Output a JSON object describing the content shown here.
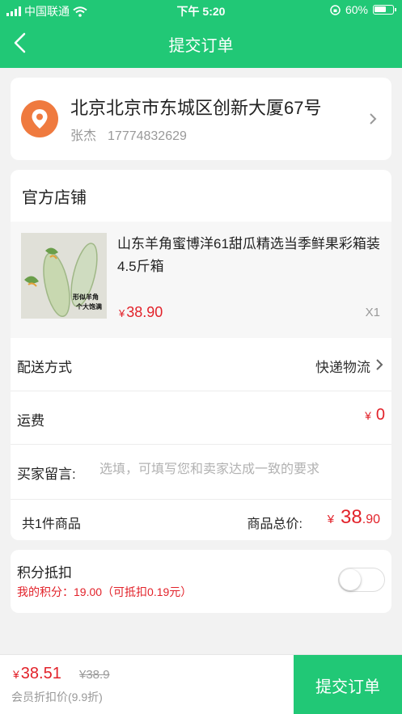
{
  "status_bar": {
    "carrier": "中国联通",
    "time": "下午 5:20",
    "battery": "60%"
  },
  "header": {
    "title": "提交订单",
    "bg_color": "#21c876"
  },
  "address": {
    "line": "北京北京市东城区创新大厦67号",
    "name": "张杰",
    "phone": "17774832629"
  },
  "shop": {
    "name": "官方店铺"
  },
  "product": {
    "title": "山东羊角蜜博洋61甜瓜精选当季鲜果彩箱装4.5斤箱",
    "image_text_1": "形似羊角",
    "image_text_2": "个大饱满",
    "currency": "¥",
    "price": "38.90",
    "qty": "X1"
  },
  "delivery": {
    "label": "配送方式",
    "value": "快递物流"
  },
  "shipping": {
    "label": "运费",
    "currency": "¥",
    "value": "0"
  },
  "message": {
    "label": "买家留言:",
    "placeholder": "选填，可填写您和卖家达成一致的要求"
  },
  "summary": {
    "count": "共1件商品",
    "total_label": "商品总价:",
    "currency": "¥",
    "total_int": "38",
    "total_dec": ".90"
  },
  "points": {
    "title": "积分抵扣",
    "info": "我的积分：19.00（可抵扣0.19元）",
    "enabled": false
  },
  "bottom": {
    "currency": "¥",
    "price": "38.51",
    "original": "¥38.9",
    "member": "会员折扣价(9.9折)",
    "submit": "提交订单"
  },
  "colors": {
    "accent": "#21c876",
    "price_red": "#e2222a",
    "location_orange": "#ef7a3f"
  }
}
